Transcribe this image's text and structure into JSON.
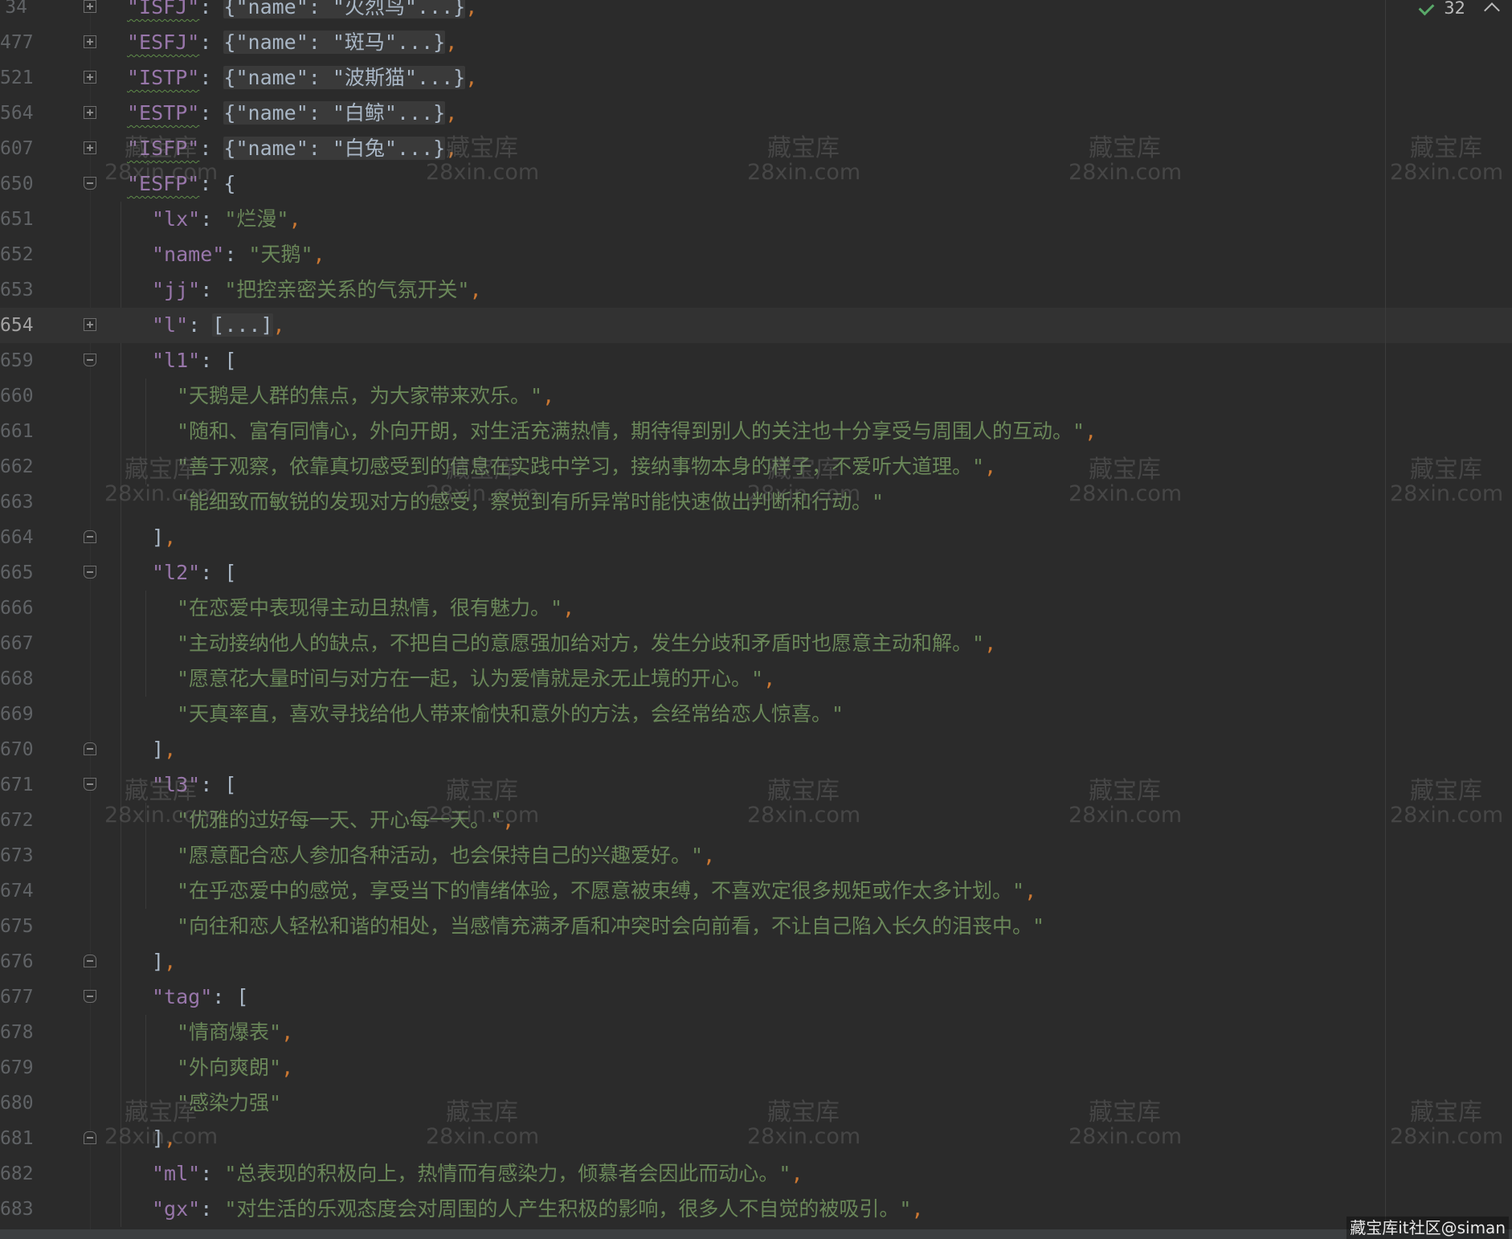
{
  "inspection": {
    "count": "32",
    "icon": "check-icon"
  },
  "lines": [
    {
      "no": "34",
      "fold": "plus",
      "tokens": [
        [
          "k sq",
          "\"ISFJ\""
        ],
        [
          "p",
          ": "
        ],
        [
          "fb",
          "{\"name\": \"火烈鸟\"...}"
        ],
        [
          "c",
          ","
        ]
      ]
    },
    {
      "no": "477",
      "fold": "plus",
      "tokens": [
        [
          "k sq",
          "\"ESFJ\""
        ],
        [
          "p",
          ": "
        ],
        [
          "fb",
          "{\"name\": \"斑马\"...}"
        ],
        [
          "c",
          ","
        ]
      ]
    },
    {
      "no": "521",
      "fold": "plus",
      "tokens": [
        [
          "k sq",
          "\"ISTP\""
        ],
        [
          "p",
          ": "
        ],
        [
          "fb",
          "{\"name\": \"波斯猫\"...}"
        ],
        [
          "c",
          ","
        ]
      ]
    },
    {
      "no": "564",
      "fold": "plus",
      "tokens": [
        [
          "k sq",
          "\"ESTP\""
        ],
        [
          "p",
          ": "
        ],
        [
          "fb",
          "{\"name\": \"白鲸\"...}"
        ],
        [
          "c",
          ","
        ]
      ]
    },
    {
      "no": "607",
      "fold": "plus",
      "tokens": [
        [
          "k sq",
          "\"ISFP\""
        ],
        [
          "p",
          ": "
        ],
        [
          "fb",
          "{\"name\": \"白兔\"...}"
        ],
        [
          "c",
          ","
        ]
      ]
    },
    {
      "no": "650",
      "fold": "open",
      "tokens": [
        [
          "k sq",
          "\"ESFP\""
        ],
        [
          "p",
          ": {"
        ]
      ]
    },
    {
      "no": "651",
      "indent": 1,
      "tokens": [
        [
          "k",
          "\"lx\""
        ],
        [
          "p",
          ": "
        ],
        [
          "s",
          "\"烂漫\""
        ],
        [
          "c",
          ","
        ]
      ]
    },
    {
      "no": "652",
      "indent": 1,
      "tokens": [
        [
          "k",
          "\"name\""
        ],
        [
          "p",
          ": "
        ],
        [
          "s",
          "\"天鹅\""
        ],
        [
          "c",
          ","
        ]
      ]
    },
    {
      "no": "653",
      "indent": 1,
      "tokens": [
        [
          "k",
          "\"jj\""
        ],
        [
          "p",
          ": "
        ],
        [
          "s",
          "\"把控亲密关系的气氛开关\""
        ],
        [
          "c",
          ","
        ]
      ]
    },
    {
      "no": "654",
      "indent": 1,
      "fold": "plus",
      "current": true,
      "tokens": [
        [
          "k",
          "\"l\""
        ],
        [
          "p",
          ": "
        ],
        [
          "fb",
          "[...]"
        ],
        [
          "c",
          ","
        ]
      ]
    },
    {
      "no": "659",
      "indent": 1,
      "fold": "open",
      "tokens": [
        [
          "k",
          "\"l1\""
        ],
        [
          "p",
          ": ["
        ]
      ]
    },
    {
      "no": "660",
      "indent": 2,
      "tokens": [
        [
          "s",
          "\"天鹅是人群的焦点，为大家带来欢乐。\""
        ],
        [
          "c",
          ","
        ]
      ]
    },
    {
      "no": "661",
      "indent": 2,
      "tokens": [
        [
          "s",
          "\"随和、富有同情心，外向开朗，对生活充满热情，期待得到别人的关注也十分享受与周围人的互动。\""
        ],
        [
          "c",
          ","
        ]
      ]
    },
    {
      "no": "662",
      "indent": 2,
      "tokens": [
        [
          "s",
          "\"善于观察，依靠真切感受到的信息在实践中学习，接纳事物本身的样子，不爱听大道理。\""
        ],
        [
          "c",
          ","
        ]
      ]
    },
    {
      "no": "663",
      "indent": 2,
      "tokens": [
        [
          "s",
          "\"能细致而敏锐的发现对方的感受，察觉到有所异常时能快速做出判断和行动。\""
        ]
      ]
    },
    {
      "no": "664",
      "indent": 1,
      "fold": "close",
      "tokens": [
        [
          "p",
          "]"
        ],
        [
          "c",
          ","
        ]
      ]
    },
    {
      "no": "665",
      "indent": 1,
      "fold": "open",
      "tokens": [
        [
          "k",
          "\"l2\""
        ],
        [
          "p",
          ": ["
        ]
      ]
    },
    {
      "no": "666",
      "indent": 2,
      "tokens": [
        [
          "s",
          "\"在恋爱中表现得主动且热情，很有魅力。\""
        ],
        [
          "c",
          ","
        ]
      ]
    },
    {
      "no": "667",
      "indent": 2,
      "tokens": [
        [
          "s",
          "\"主动接纳他人的缺点，不把自己的意愿强加给对方，发生分歧和矛盾时也愿意主动和解。\""
        ],
        [
          "c",
          ","
        ]
      ]
    },
    {
      "no": "668",
      "indent": 2,
      "tokens": [
        [
          "s",
          "\"愿意花大量时间与对方在一起，认为爱情就是永无止境的开心。\""
        ],
        [
          "c",
          ","
        ]
      ]
    },
    {
      "no": "669",
      "indent": 2,
      "tokens": [
        [
          "s",
          "\"天真率直，喜欢寻找给他人带来愉快和意外的方法，会经常给恋人惊喜。\""
        ]
      ]
    },
    {
      "no": "670",
      "indent": 1,
      "fold": "close",
      "tokens": [
        [
          "p",
          "]"
        ],
        [
          "c",
          ","
        ]
      ]
    },
    {
      "no": "671",
      "indent": 1,
      "fold": "open",
      "tokens": [
        [
          "k",
          "\"l3\""
        ],
        [
          "p",
          ": ["
        ]
      ]
    },
    {
      "no": "672",
      "indent": 2,
      "tokens": [
        [
          "s",
          "\"优雅的过好每一天、开心每一天。\""
        ],
        [
          "c",
          ","
        ]
      ]
    },
    {
      "no": "673",
      "indent": 2,
      "tokens": [
        [
          "s",
          "\"愿意配合恋人参加各种活动，也会保持自己的兴趣爱好。\""
        ],
        [
          "c",
          ","
        ]
      ]
    },
    {
      "no": "674",
      "indent": 2,
      "tokens": [
        [
          "s",
          "\"在乎恋爱中的感觉，享受当下的情绪体验，不愿意被束缚，不喜欢定很多规矩或作太多计划。\""
        ],
        [
          "c",
          ","
        ]
      ]
    },
    {
      "no": "675",
      "indent": 2,
      "tokens": [
        [
          "s",
          "\"向往和恋人轻松和谐的相处，当感情充满矛盾和冲突时会向前看，不让自己陷入长久的泪丧中。\""
        ]
      ]
    },
    {
      "no": "676",
      "indent": 1,
      "fold": "close",
      "tokens": [
        [
          "p",
          "]"
        ],
        [
          "c",
          ","
        ]
      ]
    },
    {
      "no": "677",
      "indent": 1,
      "fold": "open",
      "tokens": [
        [
          "k",
          "\"tag\""
        ],
        [
          "p",
          ": ["
        ]
      ]
    },
    {
      "no": "678",
      "indent": 2,
      "tokens": [
        [
          "s",
          "\"情商爆表\""
        ],
        [
          "c",
          ","
        ]
      ]
    },
    {
      "no": "679",
      "indent": 2,
      "tokens": [
        [
          "s",
          "\"外向爽朗\""
        ],
        [
          "c",
          ","
        ]
      ]
    },
    {
      "no": "680",
      "indent": 2,
      "tokens": [
        [
          "s",
          "\"感染力强\""
        ]
      ]
    },
    {
      "no": "681",
      "indent": 1,
      "fold": "close",
      "tokens": [
        [
          "p",
          "]"
        ],
        [
          "c",
          ","
        ]
      ]
    },
    {
      "no": "682",
      "indent": 1,
      "tokens": [
        [
          "k",
          "\"ml\""
        ],
        [
          "p",
          ": "
        ],
        [
          "s",
          "\"总表现的积极向上，热情而有感染力，倾慕者会因此而动心。\""
        ],
        [
          "c",
          ","
        ]
      ]
    },
    {
      "no": "683",
      "indent": 1,
      "tokens": [
        [
          "k",
          "\"gx\""
        ],
        [
          "p",
          ": "
        ],
        [
          "s",
          "\"对生活的乐观态度会对周围的人产生积极的影响，很多人不自觉的被吸引。\""
        ],
        [
          "c",
          ","
        ]
      ]
    }
  ],
  "watermark": {
    "cn": "藏宝库",
    "en": "28xin.com"
  },
  "footer_mark": "藏宝库it社区@siman"
}
